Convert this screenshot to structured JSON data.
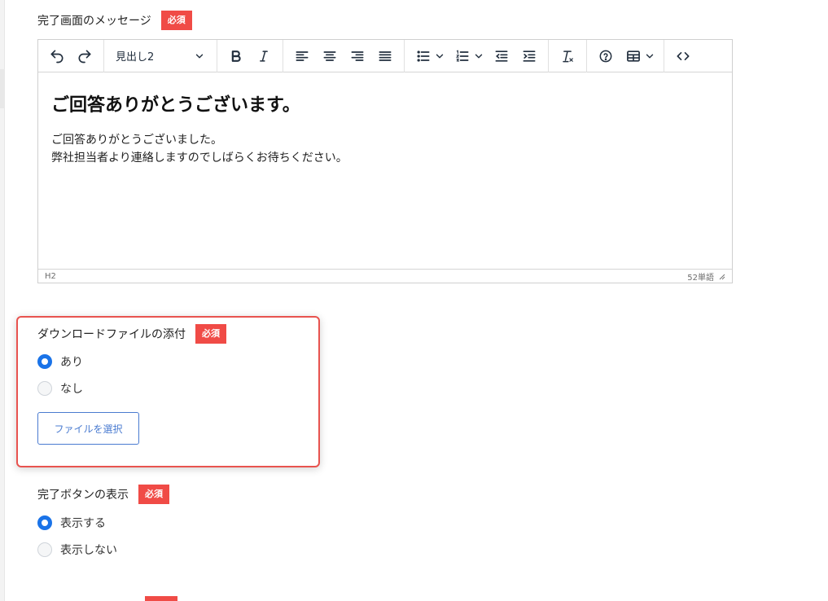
{
  "message_field": {
    "label": "完了画面のメッセージ",
    "required": "必須"
  },
  "editor": {
    "toolbar": {
      "block_format": "見出し2"
    },
    "content": {
      "heading": "ご回答ありがとうございます。",
      "line1": "ご回答ありがとうございました。",
      "line2": "弊社担当者より連絡しますのでしばらくお待ちください。"
    },
    "status": {
      "path": "H2",
      "word_count": "52単語"
    },
    "icons": [
      "undo-icon",
      "redo-icon",
      "bold-icon",
      "italic-icon",
      "align-left-icon",
      "align-center-icon",
      "align-right-icon",
      "align-justify-icon",
      "bullet-list-icon",
      "numbered-list-icon",
      "outdent-icon",
      "indent-icon",
      "clear-format-icon",
      "help-icon",
      "table-icon",
      "code-icon"
    ]
  },
  "download_field": {
    "label": "ダウンロードファイルの添付",
    "required": "必須",
    "options": [
      {
        "label": "あり",
        "checked": true
      },
      {
        "label": "なし",
        "checked": false
      }
    ],
    "file_button": "ファイルを選択"
  },
  "complete_button_field": {
    "label": "完了ボタンの表示",
    "required": "必須",
    "options": [
      {
        "label": "表示する",
        "checked": true
      },
      {
        "label": "表示しない",
        "checked": false
      }
    ]
  },
  "colors": {
    "required_badge": "#f04b46",
    "radio_checked": "#1a73e8",
    "highlight_border": "#e8534f",
    "file_button": "#4a7bd0"
  }
}
